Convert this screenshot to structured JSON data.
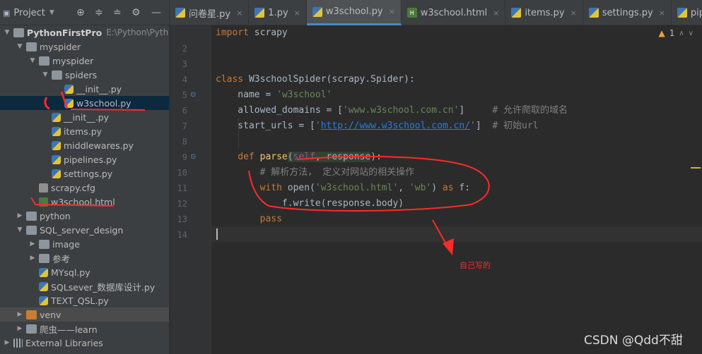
{
  "project_panel": {
    "label": "Project",
    "tree": [
      {
        "label": "PythonFirstPro",
        "path": "E:\\Python\\PythonFirstPro",
        "icon": "folder-icon"
      },
      {
        "label": "myspider",
        "icon": "folder-icon"
      },
      {
        "label": "myspider",
        "icon": "folder-icon"
      },
      {
        "label": "spiders",
        "icon": "folder-icon"
      },
      {
        "label": "__init__.py",
        "icon": "python-file-icon"
      },
      {
        "label": "w3school.py",
        "icon": "python-file-icon",
        "selected": true
      },
      {
        "label": "__init__.py",
        "icon": "python-file-icon"
      },
      {
        "label": "items.py",
        "icon": "python-file-icon"
      },
      {
        "label": "middlewares.py",
        "icon": "python-file-icon"
      },
      {
        "label": "pipelines.py",
        "icon": "python-file-icon"
      },
      {
        "label": "settings.py",
        "icon": "python-file-icon"
      },
      {
        "label": "scrapy.cfg",
        "icon": "config-file-icon"
      },
      {
        "label": "w3school.html",
        "icon": "html-file-icon"
      },
      {
        "label": "python",
        "icon": "folder-icon"
      },
      {
        "label": "SQL_server_design",
        "icon": "folder-icon"
      },
      {
        "label": "image",
        "icon": "folder-icon"
      },
      {
        "label": "参考",
        "icon": "folder-icon"
      },
      {
        "label": "MYsql.py",
        "icon": "python-file-icon"
      },
      {
        "label": "SQLsever_数据库设计.py",
        "icon": "python-file-icon"
      },
      {
        "label": "TEXT_QSL.py",
        "icon": "python-file-icon"
      },
      {
        "label": "venv",
        "icon": "folder-icon"
      },
      {
        "label": "爬虫——learn",
        "icon": "folder-icon"
      },
      {
        "label": "External Libraries",
        "icon": "library-icon"
      }
    ]
  },
  "tabs": [
    {
      "label": "问卷星.py",
      "icon": "python-file-icon"
    },
    {
      "label": "1.py",
      "icon": "python-file-icon"
    },
    {
      "label": "w3school.py",
      "icon": "python-file-icon",
      "active": true
    },
    {
      "label": "w3school.html",
      "icon": "html-file-icon"
    },
    {
      "label": "items.py",
      "icon": "python-file-icon"
    },
    {
      "label": "settings.py",
      "icon": "python-file-icon"
    },
    {
      "label": "pipelines",
      "icon": "python-file-icon"
    }
  ],
  "editor": {
    "warning_count": "1",
    "line_numbers": [
      "2",
      "3",
      "4",
      "5",
      "6",
      "7",
      "8",
      "9",
      "10",
      "11",
      "12",
      "13",
      "14"
    ],
    "code": {
      "l1_kw": "import",
      "l1_mod": " scrapy",
      "l4_kw": "class",
      "l4_name": " W3schoolSpider",
      "l4_rest": "(scrapy.Spider):",
      "l5_a": "    name = ",
      "l5_s": "'w3school'",
      "l6_a": "    allowed_domains = [",
      "l6_s": "'www.w3school.com.cn'",
      "l6_b": "]",
      "l6_c": "     # 允许爬取的域名",
      "l7_a": "    start_urls = [",
      "l7_q1": "'",
      "l7_url": "http://www.w3school.com.cn/",
      "l7_q2": "'",
      "l7_b": "]",
      "l7_c": "  # 初始url",
      "l9_kw": "    def",
      "l9_fn": " parse",
      "l9_p1": "(",
      "l9_self": "self",
      "l9_p2": ", response",
      "l9_p3": "):",
      "l10_c": "        # 解析方法， 定义对网站的相关操作",
      "l11_kw": "        with",
      "l11_a": " open(",
      "l11_s1": "'w3school.html'",
      "l11_b": ", ",
      "l11_s2": "'wb'",
      "l11_c": ") ",
      "l11_kw2": "as",
      "l11_d": " f:",
      "l12": "            f.write(response.body)",
      "l13_kw": "        pass"
    }
  },
  "annotation": "自己写的",
  "watermark": "CSDN @Qdd不甜",
  "colors": {
    "annotation": "#ff2a2a",
    "accent": "#4a88c7",
    "background": "#2b2b2b"
  }
}
